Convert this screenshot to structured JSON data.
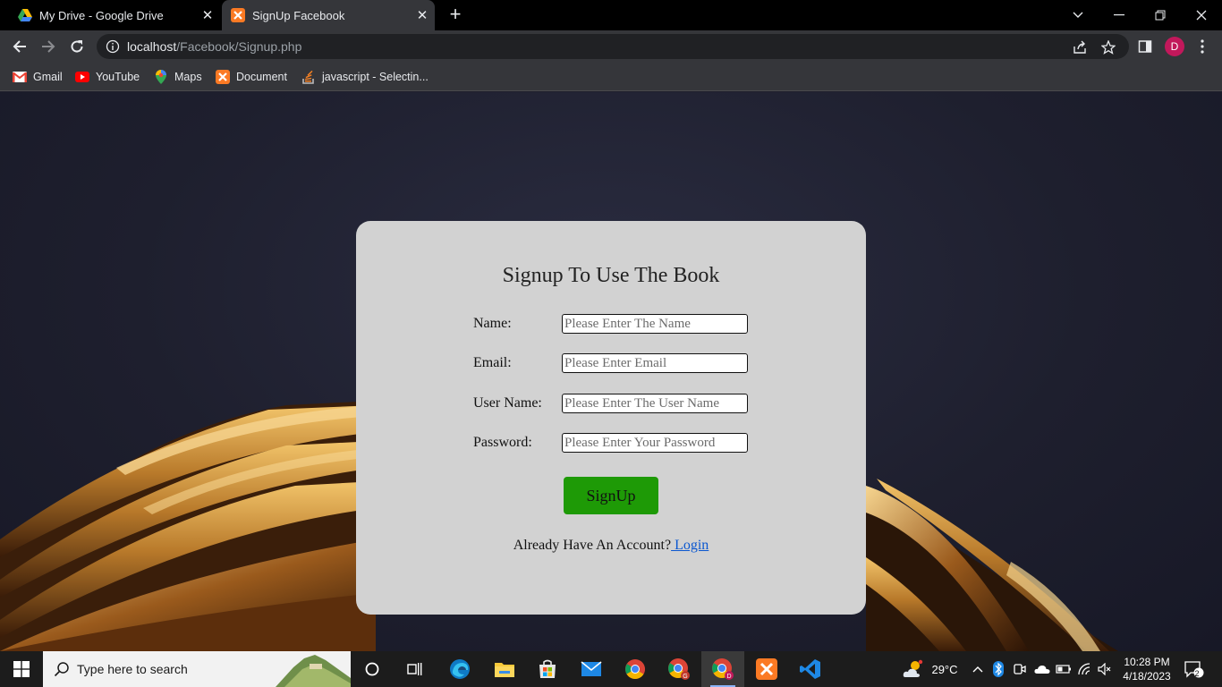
{
  "browser": {
    "tabs": [
      {
        "title": "My Drive - Google Drive",
        "icon": "google-drive-icon",
        "active": false
      },
      {
        "title": "SignUp Facebook",
        "icon": "xampp-icon",
        "active": true
      }
    ],
    "url_host": "localhost",
    "url_path": "/Facebook/Signup.php",
    "profile_initial": "D"
  },
  "bookmarks": [
    {
      "label": "Gmail",
      "icon": "gmail-icon"
    },
    {
      "label": "YouTube",
      "icon": "youtube-icon"
    },
    {
      "label": "Maps",
      "icon": "maps-icon"
    },
    {
      "label": "Document",
      "icon": "xampp-icon"
    },
    {
      "label": "javascript - Selectin...",
      "icon": "stackoverflow-icon"
    }
  ],
  "form": {
    "title": "Signup To Use The Book",
    "fields": [
      {
        "label": "Name:",
        "placeholder": "Please Enter The Name",
        "value": ""
      },
      {
        "label": "Email:",
        "placeholder": "Please Enter Email",
        "value": ""
      },
      {
        "label": "User Name:",
        "placeholder": "Please Enter The User Name",
        "value": ""
      },
      {
        "label": "Password:",
        "placeholder": "Please Enter Your Password",
        "value": ""
      }
    ],
    "submit_label": "SignUp",
    "account_prompt": "Already Have An Account?",
    "login_link": " Login"
  },
  "taskbar": {
    "search_placeholder": "Type here to search",
    "temperature": "29°C",
    "time": "10:28 PM",
    "date": "4/18/2023",
    "notification_count": "2"
  },
  "colors": {
    "card_bg": "#d2d2d2",
    "signup_button": "#1e9a06",
    "link": "#0b57d0",
    "page_bg": "#1f1f2c"
  }
}
